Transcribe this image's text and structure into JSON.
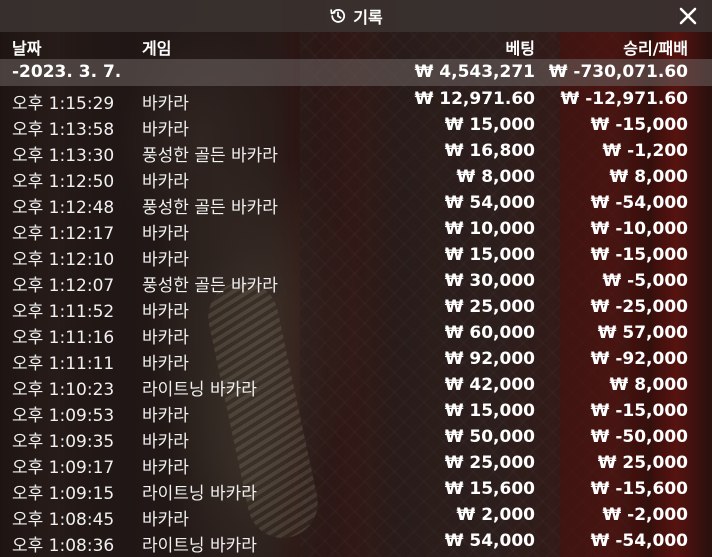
{
  "title": "기록",
  "headers": {
    "date": "날짜",
    "game": "게임",
    "bet": "베팅",
    "win_loss": "승리/패배"
  },
  "summary": {
    "date": "-2023. 3. 7.",
    "bet": "₩ 4,543,271",
    "win_loss": "₩ -730,071.60"
  },
  "rows": [
    {
      "time": "오후 1:15:29",
      "game": "바카라",
      "bet": "₩ 12,971.60",
      "win_loss": "₩ -12,971.60"
    },
    {
      "time": "오후 1:13:58",
      "game": "바카라",
      "bet": "₩ 15,000",
      "win_loss": "₩ -15,000"
    },
    {
      "time": "오후 1:13:30",
      "game": "풍성한 골든 바카라",
      "bet": "₩ 16,800",
      "win_loss": "₩ -1,200"
    },
    {
      "time": "오후 1:12:50",
      "game": "바카라",
      "bet": "₩ 8,000",
      "win_loss": "₩ 8,000"
    },
    {
      "time": "오후 1:12:48",
      "game": "풍성한 골든 바카라",
      "bet": "₩ 54,000",
      "win_loss": "₩ -54,000"
    },
    {
      "time": "오후 1:12:17",
      "game": "바카라",
      "bet": "₩ 10,000",
      "win_loss": "₩ -10,000"
    },
    {
      "time": "오후 1:12:10",
      "game": "바카라",
      "bet": "₩ 15,000",
      "win_loss": "₩ -15,000"
    },
    {
      "time": "오후 1:12:07",
      "game": "풍성한 골든 바카라",
      "bet": "₩ 30,000",
      "win_loss": "₩ -5,000"
    },
    {
      "time": "오후 1:11:52",
      "game": "바카라",
      "bet": "₩ 25,000",
      "win_loss": "₩ -25,000"
    },
    {
      "time": "오후 1:11:16",
      "game": "바카라",
      "bet": "₩ 60,000",
      "win_loss": "₩ 57,000"
    },
    {
      "time": "오후 1:11:11",
      "game": "바카라",
      "bet": "₩ 92,000",
      "win_loss": "₩ -92,000"
    },
    {
      "time": "오후 1:10:23",
      "game": "라이트닝 바카라",
      "bet": "₩ 42,000",
      "win_loss": "₩ 8,000"
    },
    {
      "time": "오후 1:09:53",
      "game": "바카라",
      "bet": "₩ 15,000",
      "win_loss": "₩ -15,000"
    },
    {
      "time": "오후 1:09:35",
      "game": "바카라",
      "bet": "₩ 50,000",
      "win_loss": "₩ -50,000"
    },
    {
      "time": "오후 1:09:17",
      "game": "바카라",
      "bet": "₩ 25,000",
      "win_loss": "₩ 25,000"
    },
    {
      "time": "오후 1:09:15",
      "game": "라이트닝 바카라",
      "bet": "₩ 15,600",
      "win_loss": "₩ -15,600"
    },
    {
      "time": "오후 1:08:45",
      "game": "바카라",
      "bet": "₩ 2,000",
      "win_loss": "₩ -2,000"
    },
    {
      "time": "오후 1:08:36",
      "game": "라이트닝 바카라",
      "bet": "₩ 54,000",
      "win_loss": "₩ -54,000"
    }
  ],
  "icons": {
    "title_icon": "history-icon",
    "close_icon": "close-icon"
  }
}
